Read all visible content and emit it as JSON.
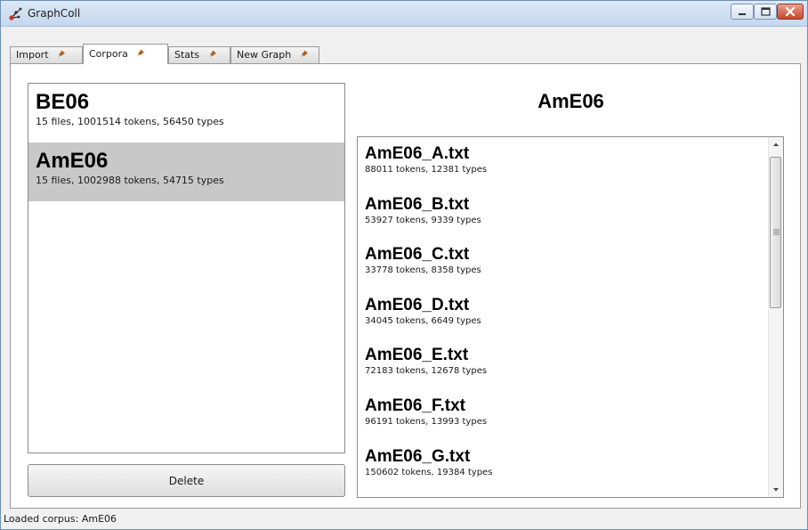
{
  "window": {
    "title": "GraphColl"
  },
  "tabs": [
    {
      "label": "Import"
    },
    {
      "label": "Corpora"
    },
    {
      "label": "Stats"
    },
    {
      "label": "New Graph"
    }
  ],
  "corpora": [
    {
      "name": "BE06",
      "info": "15 files, 1001514 tokens, 56450 types"
    },
    {
      "name": "AmE06",
      "info": "15 files, 1002988 tokens, 54715 types"
    }
  ],
  "selected_corpus": "AmE06",
  "delete_label": "Delete",
  "files": [
    {
      "name": "AmE06_A.txt",
      "info": "88011 tokens, 12381 types"
    },
    {
      "name": "AmE06_B.txt",
      "info": "53927 tokens, 9339 types"
    },
    {
      "name": "AmE06_C.txt",
      "info": "33778 tokens, 8358 types"
    },
    {
      "name": "AmE06_D.txt",
      "info": "34045 tokens, 6649 types"
    },
    {
      "name": "AmE06_E.txt",
      "info": "72183 tokens, 12678 types"
    },
    {
      "name": "AmE06_F.txt",
      "info": "96191 tokens, 13993 types"
    },
    {
      "name": "AmE06_G.txt",
      "info": "150602 tokens, 19384 types"
    }
  ],
  "status": "Loaded corpus: AmE06",
  "icons": {
    "app": "graph-app-icon",
    "pin": "pin-icon",
    "minimize": "minimize-icon",
    "maximize": "maximize-icon",
    "close": "close-icon"
  },
  "colors": {
    "selected_row": "#c8c8c8",
    "close_button": "#c8472a"
  }
}
